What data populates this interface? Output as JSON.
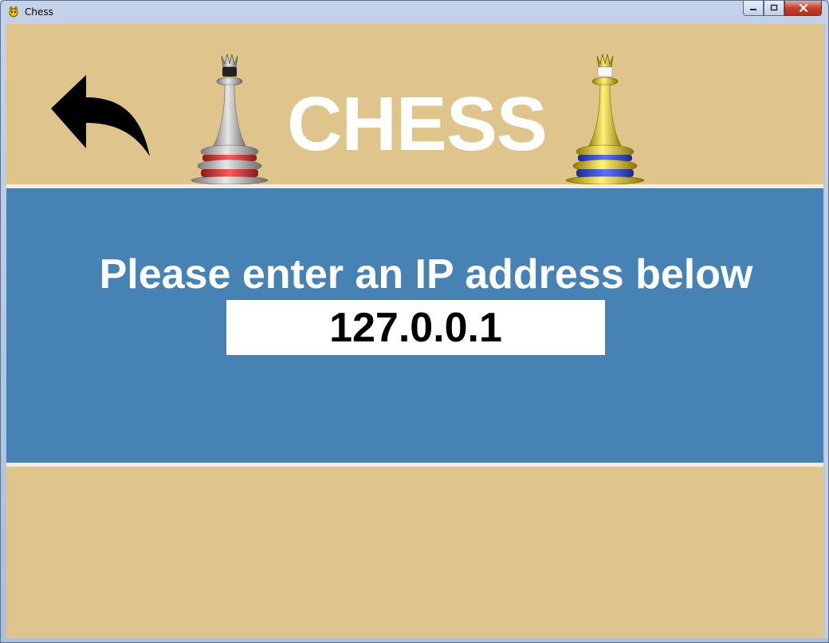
{
  "window": {
    "title": "Chess",
    "controls": {
      "minimize_icon": "minimize-icon",
      "maximize_icon": "maximize-icon",
      "close_icon": "close-icon"
    }
  },
  "header": {
    "app_title": "CHESS",
    "back_icon": "back-arrow-icon",
    "left_piece": "silver-queen-icon",
    "right_piece": "gold-queen-icon"
  },
  "connect": {
    "prompt": "Please enter an IP address below",
    "ip_value": "127.0.0.1"
  },
  "colors": {
    "board_tan": "#dfc48b",
    "panel_blue": "#4682b4",
    "separator": "#f2ece0",
    "text_white": "#ffffff",
    "silver_base": "#d63a3a",
    "gold_base": "#3a4fd6"
  }
}
